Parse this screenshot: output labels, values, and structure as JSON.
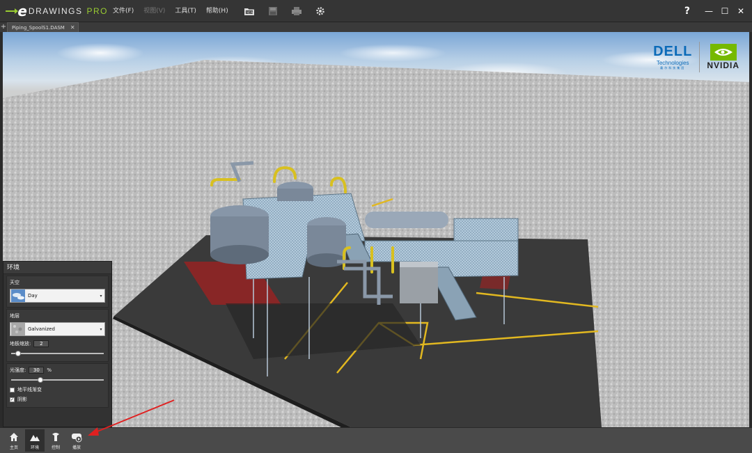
{
  "app": {
    "logo_e": "e",
    "logo_text": "DRAWINGS",
    "logo_pro": "PRO"
  },
  "menu": [
    {
      "label": "文件(F)",
      "enabled": true
    },
    {
      "label": "视图(V)",
      "enabled": false
    },
    {
      "label": "工具(T)",
      "enabled": true
    },
    {
      "label": "帮助(H)",
      "enabled": true
    }
  ],
  "toolbar": {
    "icons": [
      "open-folder-icon",
      "save-icon",
      "print-icon",
      "settings-icon"
    ]
  },
  "window": {
    "help": "?",
    "minimize": "—",
    "maximize": "☐",
    "close": "✕"
  },
  "tabs": {
    "add": "+",
    "items": [
      {
        "label": "Piping_SpoolS1.DASM",
        "close": "✕"
      }
    ]
  },
  "branding": {
    "dell": "DELL",
    "dell_sub": "Technologies",
    "dell_cn": "戴尔科技集团",
    "nvidia": "NVIDIA"
  },
  "environment": {
    "title": "环境",
    "sky": {
      "label": "天空",
      "value": "Day"
    },
    "floor": {
      "label": "地层",
      "value": "Galvanized",
      "scale_label": "地板缩放:",
      "scale_value": "2",
      "scale_fraction": 0.05
    },
    "light": {
      "label": "光强度:",
      "value": "30",
      "unit": "%",
      "fraction": 0.3
    },
    "horizon_fade": {
      "label": "地平线渐变",
      "checked": false
    },
    "shadow": {
      "label": "阴影",
      "checked": true
    }
  },
  "bottom_nav": [
    {
      "label": "主页",
      "icon": "home-icon",
      "active": false
    },
    {
      "label": "环境",
      "icon": "mountain-icon",
      "active": true
    },
    {
      "label": "控制",
      "icon": "control-icon",
      "active": false
    },
    {
      "label": "播放",
      "icon": "play-icon",
      "active": false
    }
  ],
  "colors": {
    "accent": "#9acd32",
    "annotation": "#e02020"
  }
}
